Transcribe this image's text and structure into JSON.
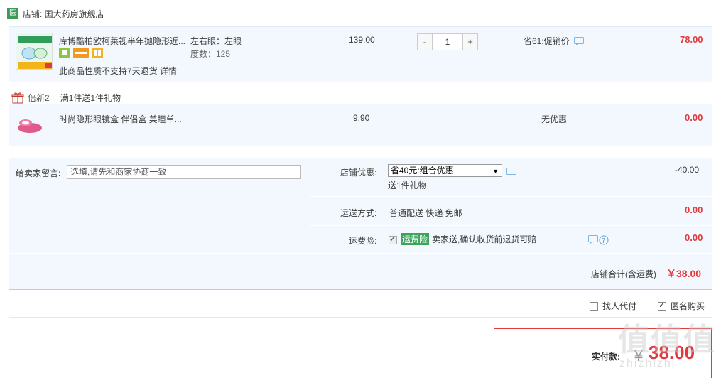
{
  "shop": {
    "badge": "医",
    "name": "店铺: 国大药房旗舰店"
  },
  "item1": {
    "title": "库博酷柏欧柯莱视半年抛隐形近...",
    "spec_eye": "左右眼：左眼",
    "spec_degree": "度数：125",
    "notice": "此商品性质不支持7天退货 详情",
    "price": "139.00",
    "qty_minus": "-",
    "qty_value": "1",
    "qty_plus": "+",
    "promo": "省61:促销价",
    "subtotal": "78.00"
  },
  "gift": {
    "label": "倍新2",
    "desc": "满1件送1件礼物",
    "title": "时尚隐形眼镜盒 伴侣盒 美瞳单...",
    "price": "9.90",
    "promo": "无优惠",
    "subtotal": "0.00"
  },
  "order": {
    "msg_label": "给卖家留言:",
    "msg_placeholder": "选填,请先和商家协商一致",
    "discount_label": "店铺优惠:",
    "discount_selected": "省40元:组合优惠",
    "discount_note": "送1件礼物",
    "discount_value": "-40.00",
    "shipping_label": "运送方式:",
    "shipping_value": "普通配送 快递 免邮",
    "shipping_fee": "0.00",
    "insurance_label": "运费险:",
    "insurance_tag": "运费险",
    "insurance_desc": "卖家送,确认收货前退货可赔",
    "insurance_fee": "0.00",
    "total_label": "店铺合计(含运费)",
    "total_value": "￥38.00"
  },
  "options": {
    "proxy_pay": "找人代付",
    "anonymous": "匿名购买",
    "anonymous_checked": true
  },
  "payment": {
    "label": "实付款:",
    "currency": "￥",
    "amount": "38.00"
  },
  "watermark": {
    "big": "值值值",
    "small": "zhizhizhi"
  },
  "colors": {
    "accent_red": "#e4393c",
    "shop_green": "#3c9a55",
    "row_bg": "#f3f8fe"
  }
}
